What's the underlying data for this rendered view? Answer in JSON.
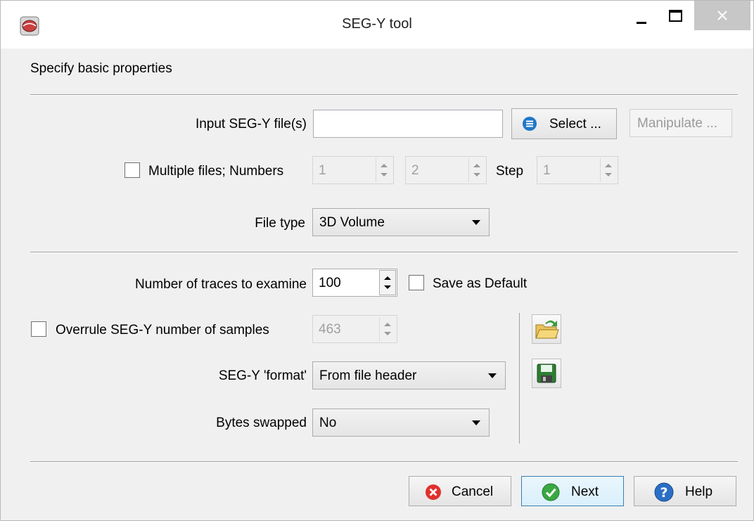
{
  "window": {
    "title": "SEG-Y tool"
  },
  "header": {
    "heading": "Specify basic properties"
  },
  "input_file": {
    "label": "Input SEG-Y file(s)",
    "value": "",
    "select_label": "Select ...",
    "manipulate_label": "Manipulate ..."
  },
  "multiple_files": {
    "label": "Multiple files; Numbers",
    "checked": false,
    "start": "1",
    "stop": "2",
    "step_label": "Step",
    "step": "1"
  },
  "file_type": {
    "label": "File type",
    "value": "3D Volume"
  },
  "traces": {
    "label": "Number of traces to examine",
    "value": "100",
    "save_default_label": "Save as Default"
  },
  "samples": {
    "label": "Overrule SEG-Y number of samples",
    "value": "463"
  },
  "format": {
    "label": "SEG-Y 'format'",
    "value": "From file header"
  },
  "bytes_swapped": {
    "label": "Bytes swapped",
    "value": "No"
  },
  "footer": {
    "cancel_label": "Cancel",
    "next_label": "Next",
    "help_label": "Help"
  },
  "icons": {
    "app": "segy-app-icon",
    "open_setup": "open-folder-icon",
    "save_setup": "save-disk-icon",
    "select": "list-icon",
    "cancel": "cancel-icon",
    "next": "check-icon",
    "help": "help-icon"
  },
  "colors": {
    "close_button": "#c7c7c7",
    "select_icon": "#1f78c8",
    "cancel_icon": "#e0312c",
    "next_icon": "#3aa843",
    "help_icon": "#2a6fc4",
    "focus_border": "#3c7fb1"
  }
}
